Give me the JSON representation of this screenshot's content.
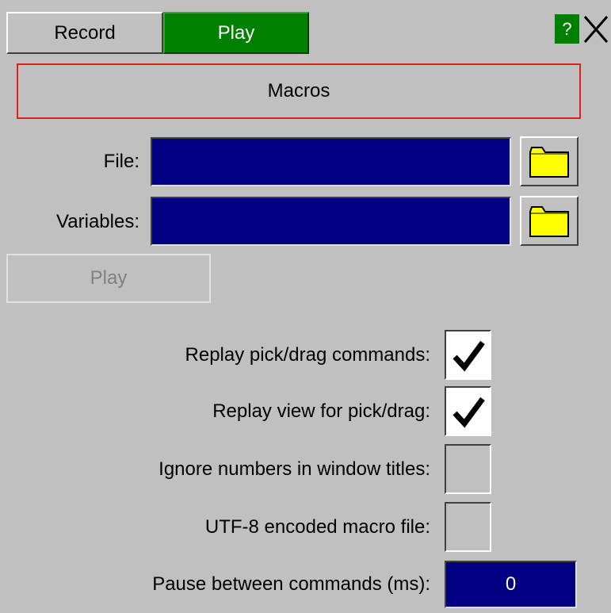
{
  "tabs": {
    "record_label": "Record",
    "play_label": "Play",
    "active": "Play"
  },
  "window_controls": {
    "help_label": "?",
    "close_icon": "close-icon"
  },
  "macros_button": {
    "label": "Macros"
  },
  "fields": {
    "file_label": "File:",
    "file_value": "",
    "variables_label": "Variables:",
    "variables_value": ""
  },
  "folder_icon": "folder-icon",
  "play_button": {
    "label": "Play",
    "enabled": false
  },
  "options": [
    {
      "label": "Replay pick/drag commands:",
      "checked": true
    },
    {
      "label": "Replay view for pick/drag:",
      "checked": true
    },
    {
      "label": "Ignore numbers in window titles:",
      "checked": false
    },
    {
      "label": "UTF-8 encoded macro file:",
      "checked": false
    }
  ],
  "pause": {
    "label": "Pause between commands (ms):",
    "value": "0"
  },
  "colors": {
    "background": "#c0c0c0",
    "active_tab": "#008000",
    "field_bg": "#000080",
    "folder": "#ffff00",
    "macros_border": "#e02020"
  }
}
